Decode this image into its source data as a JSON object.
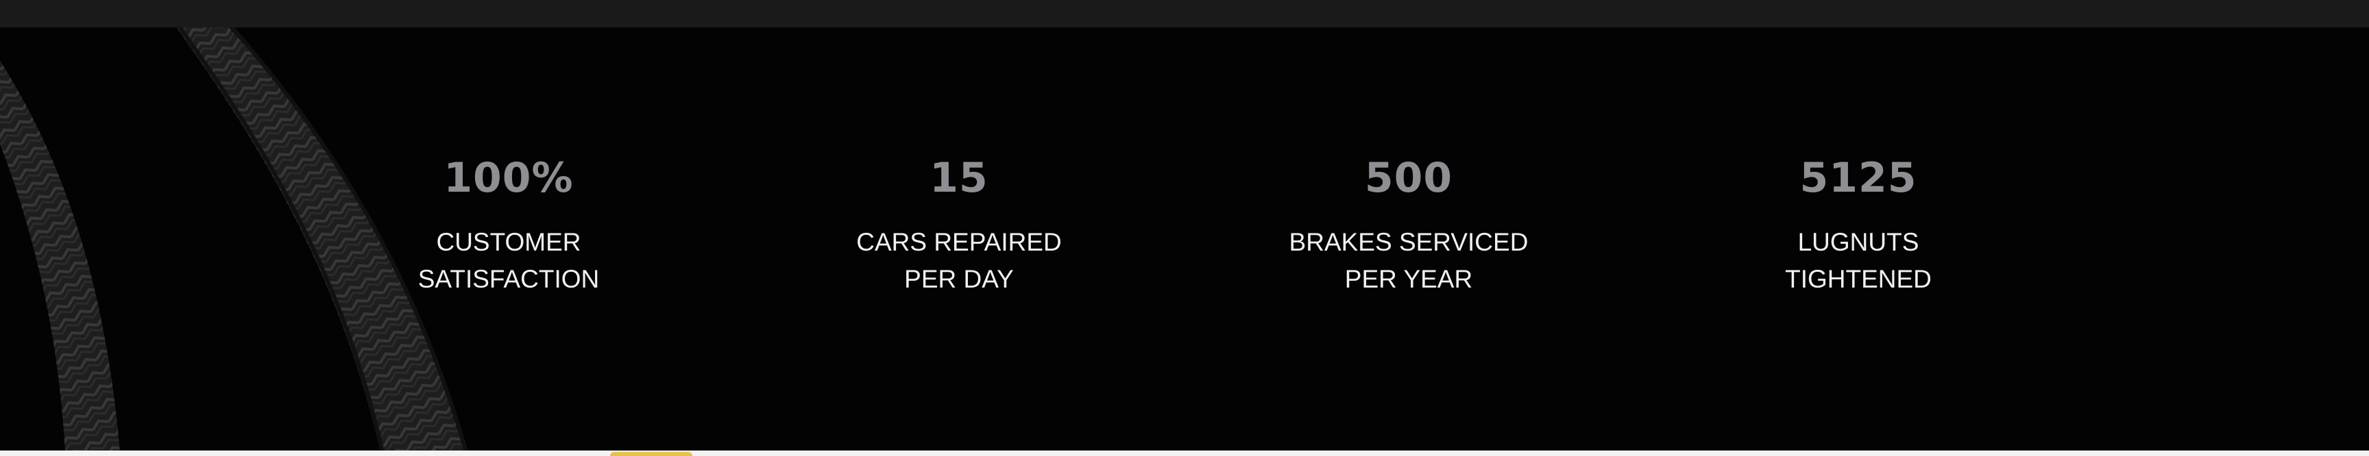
{
  "stats": [
    {
      "value": "100%",
      "label_line1": "CUSTOMER",
      "label_line2": "SATISFACTION"
    },
    {
      "value": "15",
      "label_line1": "CARS REPAIRED",
      "label_line2": "PER DAY"
    },
    {
      "value": "500",
      "label_line1": "BRAKES SERVICED",
      "label_line2": "PER YEAR"
    },
    {
      "value": "5125",
      "label_line1": "LUGNUTS",
      "label_line2": "TIGHTENED"
    }
  ],
  "colors": {
    "background": "#030303",
    "top_bar": "#1a1a1a",
    "value_text": "#8f8f93",
    "label_text": "#f2f2f2"
  },
  "decor": {
    "background_icon": "tire-track-icon"
  }
}
